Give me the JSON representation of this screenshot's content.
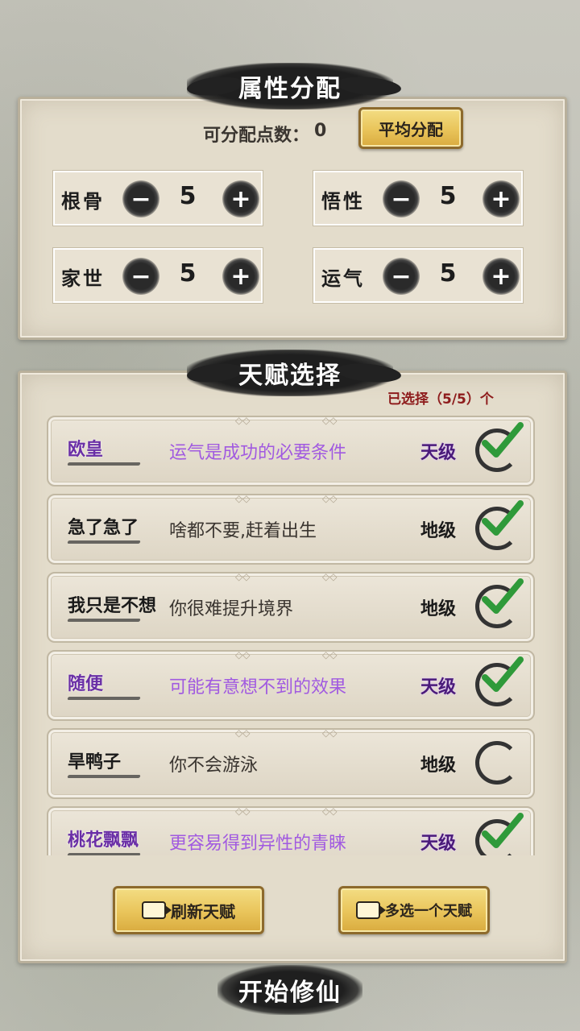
{
  "attribute_panel": {
    "title": "属性分配",
    "points_label": "可分配点数：",
    "points_value": "0",
    "average_button": "平均分配",
    "stats": [
      {
        "label": "根骨",
        "value": "5"
      },
      {
        "label": "悟性",
        "value": "5"
      },
      {
        "label": "家世",
        "value": "5"
      },
      {
        "label": "运气",
        "value": "5"
      }
    ],
    "minus_symbol": "−",
    "plus_symbol": "+"
  },
  "talent_panel": {
    "title": "天赋选择",
    "selected_text": "已选择（5/5）个",
    "talents": [
      {
        "name": "欧皇",
        "desc": "运气是成功的必要条件",
        "grade": "天级",
        "selected": true,
        "rarity": "purple"
      },
      {
        "name": "急了急了",
        "desc": "啥都不要,赶着出生",
        "grade": "地级",
        "selected": true,
        "rarity": "normal"
      },
      {
        "name": "我只是不想",
        "desc": "你很难提升境界",
        "grade": "地级",
        "selected": true,
        "rarity": "normal"
      },
      {
        "name": "随便",
        "desc": "可能有意想不到的效果",
        "grade": "天级",
        "selected": true,
        "rarity": "purple"
      },
      {
        "name": "旱鸭子",
        "desc": "你不会游泳",
        "grade": "地级",
        "selected": false,
        "rarity": "normal"
      },
      {
        "name": "桃花飘飘",
        "desc": "更容易得到异性的青睐",
        "grade": "天级",
        "selected": true,
        "rarity": "purple"
      }
    ],
    "refresh_button": "刷新天赋",
    "multi_button": "多选一个天赋",
    "button_icon": "video-icon"
  },
  "start_button": "开始修仙",
  "colors": {
    "purple_name": "#6a2fa6",
    "purple_desc": "#a15ae0",
    "check_green": "#2f9a3a",
    "gold_button": "#e9c45a",
    "count_red": "#8e1c1c"
  }
}
